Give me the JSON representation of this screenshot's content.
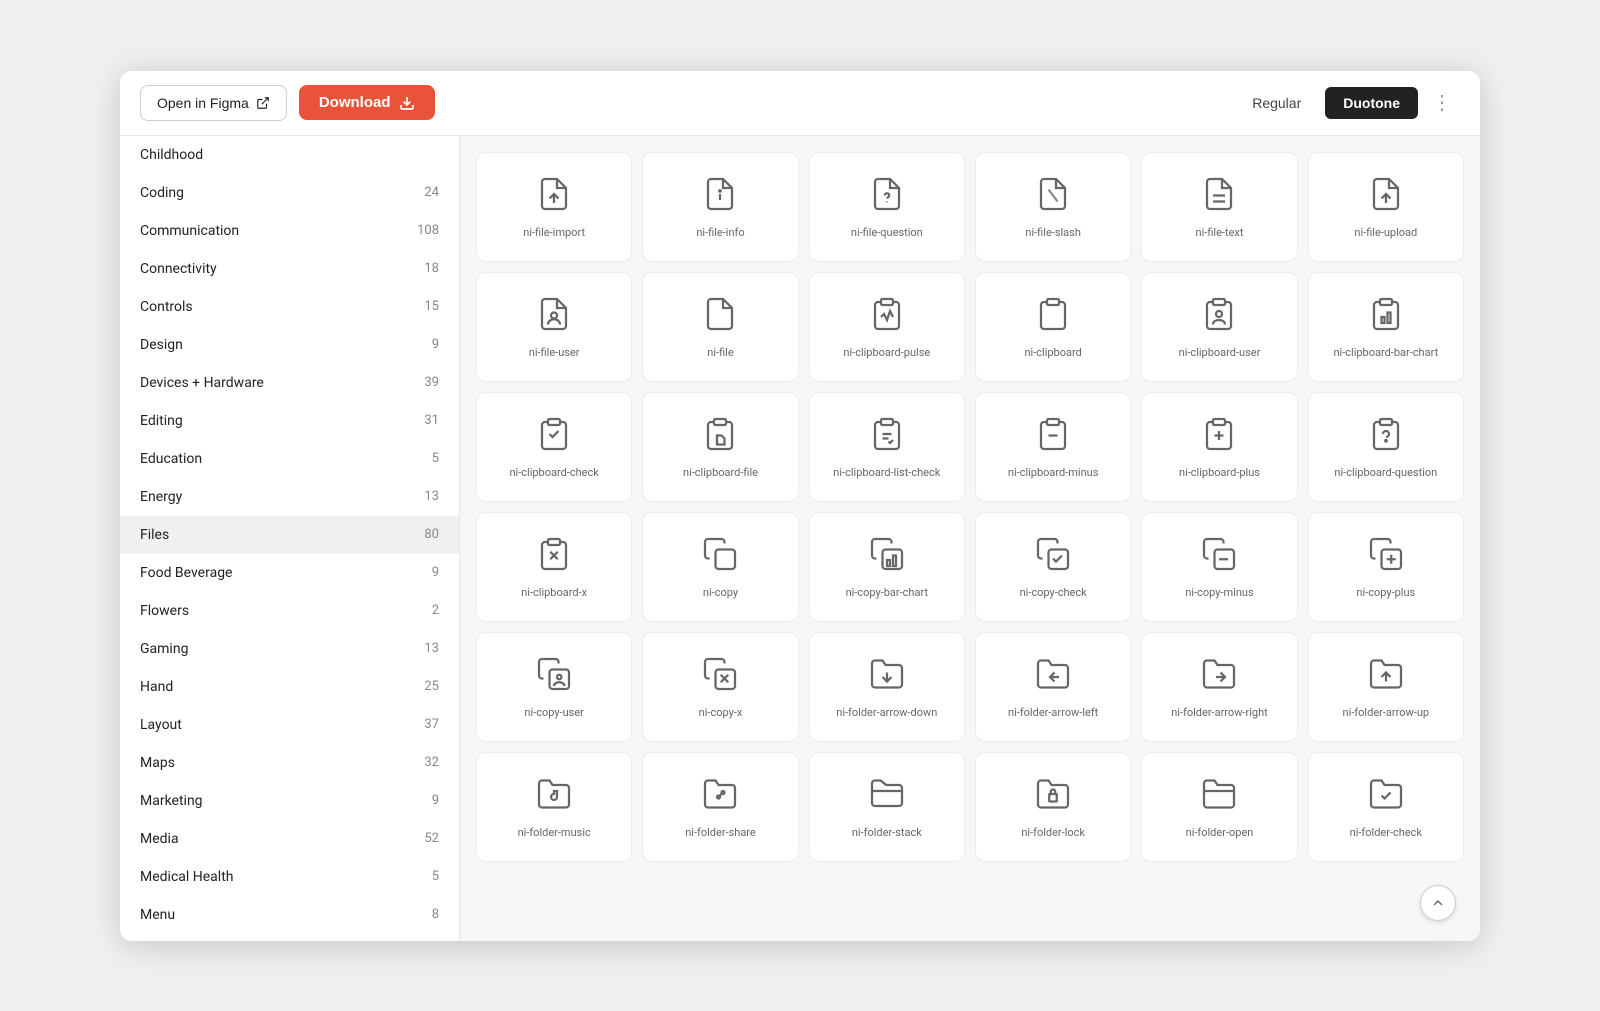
{
  "header": {
    "open_figma_label": "Open in Figma",
    "download_label": "Download",
    "tab_regular": "Regular",
    "tab_duotone": "Duotone"
  },
  "sidebar": {
    "items": [
      {
        "label": "Childhood",
        "count": ""
      },
      {
        "label": "Coding",
        "count": "24"
      },
      {
        "label": "Communication",
        "count": "108"
      },
      {
        "label": "Connectivity",
        "count": "18"
      },
      {
        "label": "Controls",
        "count": "15"
      },
      {
        "label": "Design",
        "count": "9"
      },
      {
        "label": "Devices + Hardware",
        "count": "39"
      },
      {
        "label": "Editing",
        "count": "31"
      },
      {
        "label": "Education",
        "count": "5"
      },
      {
        "label": "Energy",
        "count": "13"
      },
      {
        "label": "Files",
        "count": "80"
      },
      {
        "label": "Food Beverage",
        "count": "9"
      },
      {
        "label": "Flowers",
        "count": "2"
      },
      {
        "label": "Gaming",
        "count": "13"
      },
      {
        "label": "Hand",
        "count": "25"
      },
      {
        "label": "Layout",
        "count": "37"
      },
      {
        "label": "Maps",
        "count": "32"
      },
      {
        "label": "Marketing",
        "count": "9"
      },
      {
        "label": "Media",
        "count": "52"
      },
      {
        "label": "Medical Health",
        "count": "5"
      },
      {
        "label": "Menu",
        "count": "8"
      }
    ],
    "active_index": 10
  },
  "icons": [
    {
      "name": "ni-file-import",
      "symbol": "file-import"
    },
    {
      "name": "ni-file-info",
      "symbol": "file-info"
    },
    {
      "name": "ni-file-question",
      "symbol": "file-question"
    },
    {
      "name": "ni-file-slash",
      "symbol": "file-slash"
    },
    {
      "name": "ni-file-text",
      "symbol": "file-text"
    },
    {
      "name": "ni-file-upload",
      "symbol": "file-upload"
    },
    {
      "name": "ni-file-user",
      "symbol": "file-user"
    },
    {
      "name": "ni-file",
      "symbol": "file"
    },
    {
      "name": "ni-clipboard-pulse",
      "symbol": "clipboard-pulse"
    },
    {
      "name": "ni-clipboard",
      "symbol": "clipboard"
    },
    {
      "name": "ni-clipboard-user",
      "symbol": "clipboard-user"
    },
    {
      "name": "ni-clipboard-bar-chart",
      "symbol": "clipboard-bar-chart"
    },
    {
      "name": "ni-clipboard-check",
      "symbol": "clipboard-check"
    },
    {
      "name": "ni-clipboard-file",
      "symbol": "clipboard-file"
    },
    {
      "name": "ni-clipboard-list-check",
      "symbol": "clipboard-list-check"
    },
    {
      "name": "ni-clipboard-minus",
      "symbol": "clipboard-minus"
    },
    {
      "name": "ni-clipboard-plus",
      "symbol": "clipboard-plus"
    },
    {
      "name": "ni-clipboard-question",
      "symbol": "clipboard-question"
    },
    {
      "name": "ni-clipboard-x",
      "symbol": "clipboard-x"
    },
    {
      "name": "ni-copy",
      "symbol": "copy"
    },
    {
      "name": "ni-copy-bar-chart",
      "symbol": "copy-bar-chart"
    },
    {
      "name": "ni-copy-check",
      "symbol": "copy-check"
    },
    {
      "name": "ni-copy-minus",
      "symbol": "copy-minus"
    },
    {
      "name": "ni-copy-plus",
      "symbol": "copy-plus"
    },
    {
      "name": "ni-copy-user",
      "symbol": "copy-user"
    },
    {
      "name": "ni-copy-x",
      "symbol": "copy-x"
    },
    {
      "name": "ni-folder-arrow-down",
      "symbol": "folder-arrow-down"
    },
    {
      "name": "ni-folder-arrow-left",
      "symbol": "folder-arrow-left"
    },
    {
      "name": "ni-folder-arrow-right",
      "symbol": "folder-arrow-right"
    },
    {
      "name": "ni-folder-arrow-up",
      "symbol": "folder-arrow-up"
    },
    {
      "name": "ni-folder-music",
      "symbol": "folder-music"
    },
    {
      "name": "ni-folder-share",
      "symbol": "folder-share"
    },
    {
      "name": "ni-folder-stack",
      "symbol": "folder-stack"
    },
    {
      "name": "ni-folder-lock",
      "symbol": "folder-lock"
    },
    {
      "name": "ni-folder-open",
      "symbol": "folder-open"
    },
    {
      "name": "ni-folder-check",
      "symbol": "folder-check"
    }
  ],
  "colors": {
    "accent": "#e8533a",
    "active_bg": "#f0f0f0",
    "border": "#ececec"
  }
}
